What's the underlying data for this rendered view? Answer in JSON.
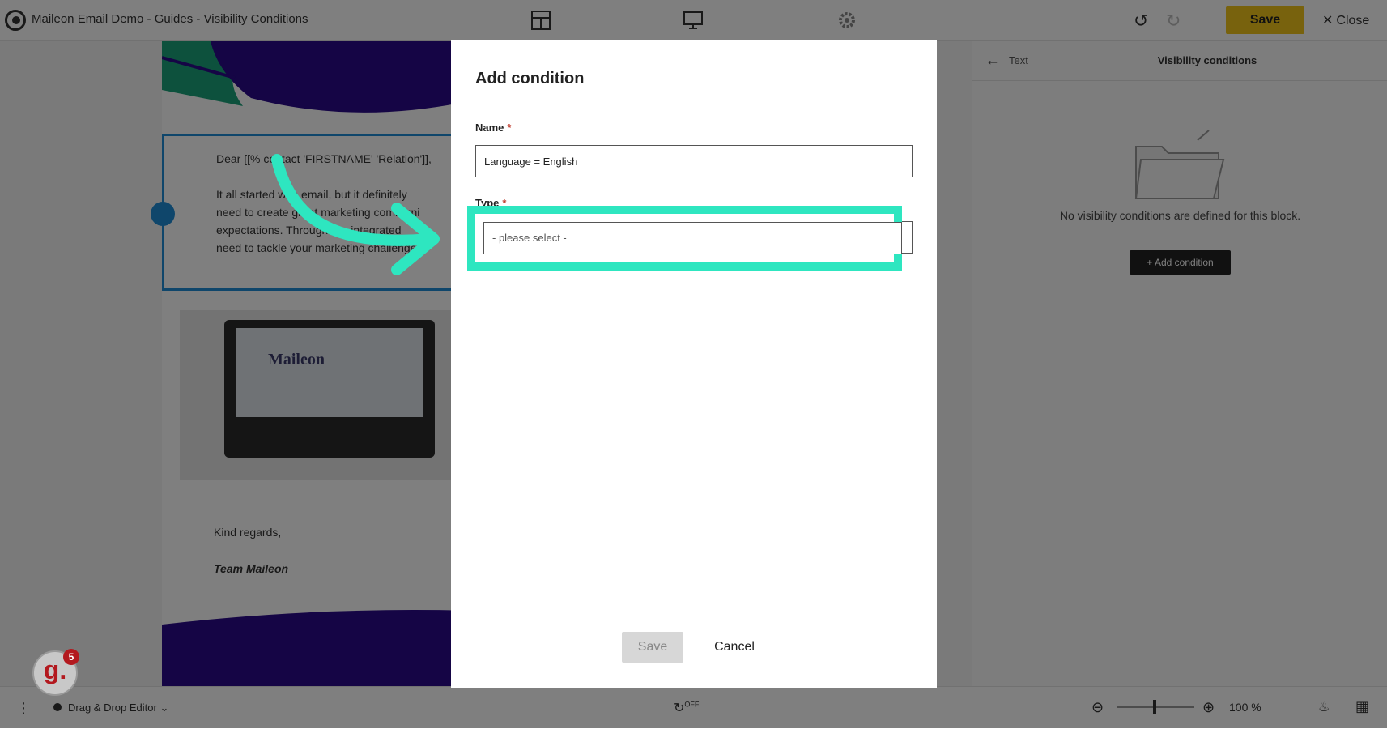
{
  "topbar": {
    "title": "Maileon Email Demo - Guides - Visibility Conditions",
    "save_label": "Save",
    "close_label": "Close"
  },
  "email": {
    "greeting": "Dear [[% contact 'FIRSTNAME' 'Relation']],",
    "body_lines": [
      "It all started with email, but it definitely",
      "need to create great marketing communi",
      "expectations. Through our integrated",
      "need to tackle your marketing challenge"
    ],
    "image_brand": "Maileon",
    "kind_regards": "Kind regards,",
    "team": "Team Maileon"
  },
  "right_panel": {
    "back_label": "Text",
    "title": "Visibility conditions",
    "empty_text": "No visibility conditions are defined for this block.",
    "add_button": "+ Add condition"
  },
  "bottombar": {
    "editor_label": "Drag & Drop Editor",
    "autosave": "OFF",
    "zoom": "100 %"
  },
  "modal": {
    "title": "Add condition",
    "name_label": "Name",
    "name_value": "Language = English",
    "type_label": "Type",
    "type_placeholder": "- please select -",
    "save_label": "Save",
    "cancel_label": "Cancel"
  },
  "guide": {
    "letter": "g.",
    "count": "5"
  },
  "colors": {
    "accent_yellow": "#f0c41b",
    "highlight_teal": "#2ee6c0",
    "selection_blue": "#1f8dd6",
    "wave_purple": "#2a0a8a",
    "wave_green": "#1aa37a",
    "badge_red": "#b3191f"
  }
}
